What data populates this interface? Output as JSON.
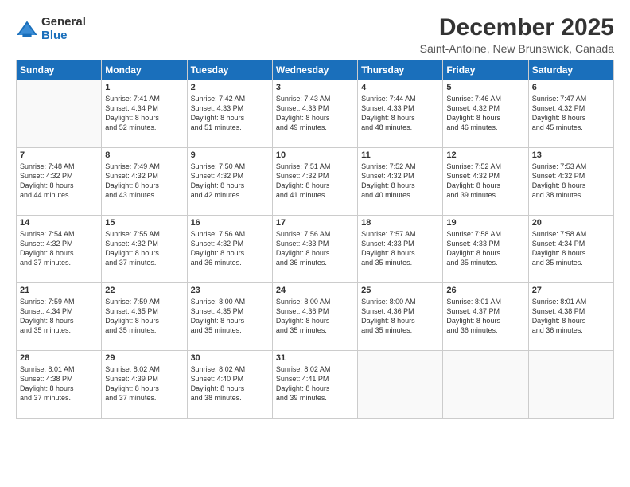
{
  "logo": {
    "general": "General",
    "blue": "Blue"
  },
  "title": "December 2025",
  "location": "Saint-Antoine, New Brunswick, Canada",
  "days_of_week": [
    "Sunday",
    "Monday",
    "Tuesday",
    "Wednesday",
    "Thursday",
    "Friday",
    "Saturday"
  ],
  "weeks": [
    [
      {
        "day": "",
        "info": ""
      },
      {
        "day": "1",
        "info": "Sunrise: 7:41 AM\nSunset: 4:34 PM\nDaylight: 8 hours\nand 52 minutes."
      },
      {
        "day": "2",
        "info": "Sunrise: 7:42 AM\nSunset: 4:33 PM\nDaylight: 8 hours\nand 51 minutes."
      },
      {
        "day": "3",
        "info": "Sunrise: 7:43 AM\nSunset: 4:33 PM\nDaylight: 8 hours\nand 49 minutes."
      },
      {
        "day": "4",
        "info": "Sunrise: 7:44 AM\nSunset: 4:33 PM\nDaylight: 8 hours\nand 48 minutes."
      },
      {
        "day": "5",
        "info": "Sunrise: 7:46 AM\nSunset: 4:32 PM\nDaylight: 8 hours\nand 46 minutes."
      },
      {
        "day": "6",
        "info": "Sunrise: 7:47 AM\nSunset: 4:32 PM\nDaylight: 8 hours\nand 45 minutes."
      }
    ],
    [
      {
        "day": "7",
        "info": "Sunrise: 7:48 AM\nSunset: 4:32 PM\nDaylight: 8 hours\nand 44 minutes."
      },
      {
        "day": "8",
        "info": "Sunrise: 7:49 AM\nSunset: 4:32 PM\nDaylight: 8 hours\nand 43 minutes."
      },
      {
        "day": "9",
        "info": "Sunrise: 7:50 AM\nSunset: 4:32 PM\nDaylight: 8 hours\nand 42 minutes."
      },
      {
        "day": "10",
        "info": "Sunrise: 7:51 AM\nSunset: 4:32 PM\nDaylight: 8 hours\nand 41 minutes."
      },
      {
        "day": "11",
        "info": "Sunrise: 7:52 AM\nSunset: 4:32 PM\nDaylight: 8 hours\nand 40 minutes."
      },
      {
        "day": "12",
        "info": "Sunrise: 7:52 AM\nSunset: 4:32 PM\nDaylight: 8 hours\nand 39 minutes."
      },
      {
        "day": "13",
        "info": "Sunrise: 7:53 AM\nSunset: 4:32 PM\nDaylight: 8 hours\nand 38 minutes."
      }
    ],
    [
      {
        "day": "14",
        "info": "Sunrise: 7:54 AM\nSunset: 4:32 PM\nDaylight: 8 hours\nand 37 minutes."
      },
      {
        "day": "15",
        "info": "Sunrise: 7:55 AM\nSunset: 4:32 PM\nDaylight: 8 hours\nand 37 minutes."
      },
      {
        "day": "16",
        "info": "Sunrise: 7:56 AM\nSunset: 4:32 PM\nDaylight: 8 hours\nand 36 minutes."
      },
      {
        "day": "17",
        "info": "Sunrise: 7:56 AM\nSunset: 4:33 PM\nDaylight: 8 hours\nand 36 minutes."
      },
      {
        "day": "18",
        "info": "Sunrise: 7:57 AM\nSunset: 4:33 PM\nDaylight: 8 hours\nand 35 minutes."
      },
      {
        "day": "19",
        "info": "Sunrise: 7:58 AM\nSunset: 4:33 PM\nDaylight: 8 hours\nand 35 minutes."
      },
      {
        "day": "20",
        "info": "Sunrise: 7:58 AM\nSunset: 4:34 PM\nDaylight: 8 hours\nand 35 minutes."
      }
    ],
    [
      {
        "day": "21",
        "info": "Sunrise: 7:59 AM\nSunset: 4:34 PM\nDaylight: 8 hours\nand 35 minutes."
      },
      {
        "day": "22",
        "info": "Sunrise: 7:59 AM\nSunset: 4:35 PM\nDaylight: 8 hours\nand 35 minutes."
      },
      {
        "day": "23",
        "info": "Sunrise: 8:00 AM\nSunset: 4:35 PM\nDaylight: 8 hours\nand 35 minutes."
      },
      {
        "day": "24",
        "info": "Sunrise: 8:00 AM\nSunset: 4:36 PM\nDaylight: 8 hours\nand 35 minutes."
      },
      {
        "day": "25",
        "info": "Sunrise: 8:00 AM\nSunset: 4:36 PM\nDaylight: 8 hours\nand 35 minutes."
      },
      {
        "day": "26",
        "info": "Sunrise: 8:01 AM\nSunset: 4:37 PM\nDaylight: 8 hours\nand 36 minutes."
      },
      {
        "day": "27",
        "info": "Sunrise: 8:01 AM\nSunset: 4:38 PM\nDaylight: 8 hours\nand 36 minutes."
      }
    ],
    [
      {
        "day": "28",
        "info": "Sunrise: 8:01 AM\nSunset: 4:38 PM\nDaylight: 8 hours\nand 37 minutes."
      },
      {
        "day": "29",
        "info": "Sunrise: 8:02 AM\nSunset: 4:39 PM\nDaylight: 8 hours\nand 37 minutes."
      },
      {
        "day": "30",
        "info": "Sunrise: 8:02 AM\nSunset: 4:40 PM\nDaylight: 8 hours\nand 38 minutes."
      },
      {
        "day": "31",
        "info": "Sunrise: 8:02 AM\nSunset: 4:41 PM\nDaylight: 8 hours\nand 39 minutes."
      },
      {
        "day": "",
        "info": ""
      },
      {
        "day": "",
        "info": ""
      },
      {
        "day": "",
        "info": ""
      }
    ]
  ]
}
